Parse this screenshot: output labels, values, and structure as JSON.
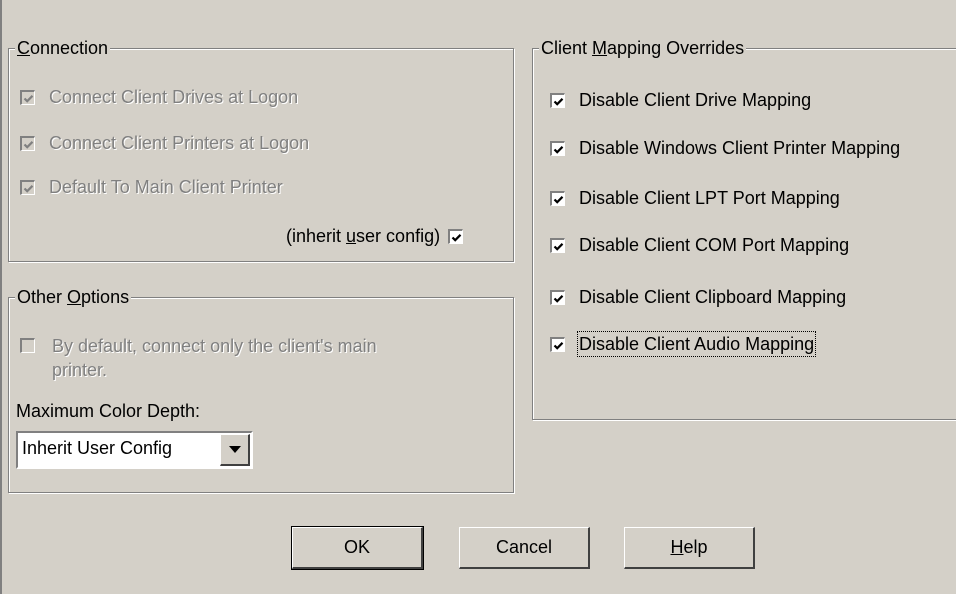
{
  "connection": {
    "legend_pre": "",
    "legend_ul": "C",
    "legend_post": "onnection",
    "items": [
      {
        "label": "Connect Client Drives at Logon",
        "checked": true,
        "enabled": false
      },
      {
        "label": "Connect Client Printers at Logon",
        "checked": true,
        "enabled": false
      },
      {
        "label": "Default To Main Client Printer",
        "checked": true,
        "enabled": false
      }
    ],
    "inherit": {
      "pre": "(inherit ",
      "ul": "u",
      "post": "ser config)",
      "checked": true
    }
  },
  "other_options": {
    "legend_pre": "Other ",
    "legend_ul": "O",
    "legend_post": "ptions",
    "default_printer": {
      "line1": "By default, connect only the client's main",
      "line2": "printer.",
      "checked": false,
      "enabled": false
    },
    "color_depth_label": "Maximum Color Depth:",
    "color_depth_value": "Inherit User Config"
  },
  "overrides": {
    "legend_pre": "Client ",
    "legend_ul": "M",
    "legend_post": "apping Overrides",
    "items": [
      {
        "label": "Disable Client Drive Mapping",
        "checked": true
      },
      {
        "label": "Disable Windows Client Printer Mapping",
        "checked": true
      },
      {
        "label": "Disable Client LPT Port Mapping",
        "checked": true
      },
      {
        "label": "Disable Client COM Port Mapping",
        "checked": true
      },
      {
        "label": "Disable Client Clipboard Mapping",
        "checked": true
      },
      {
        "label": "Disable Client Audio Mapping",
        "checked": true
      }
    ]
  },
  "buttons": {
    "ok": "OK",
    "cancel": "Cancel",
    "help_ul": "H",
    "help_post": "elp"
  },
  "icons": {
    "check": "check-icon",
    "dropdown": "chevron-down-icon"
  }
}
